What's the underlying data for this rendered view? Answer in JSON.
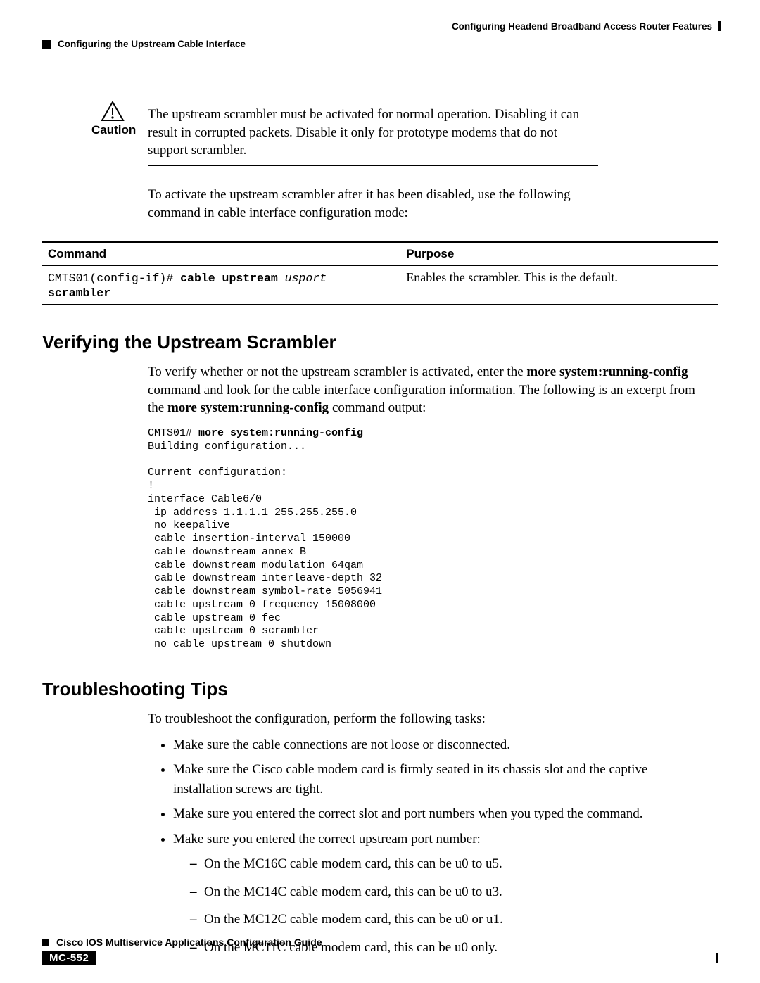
{
  "header": {
    "chapter": "Configuring Headend Broadband Access Router Features",
    "section": "Configuring the Upstream Cable Interface"
  },
  "caution": {
    "label": "Caution",
    "text": "The upstream scrambler must be activated for normal operation. Disabling it can result in corrupted packets. Disable it only for prototype modems that do not support scrambler."
  },
  "intro_para": "To activate the upstream scrambler after it has been disabled, use the following command in cable interface configuration mode:",
  "table": {
    "headers": [
      "Command",
      "Purpose"
    ],
    "row": {
      "prompt": "CMTS01(config-if)# ",
      "cmd1": "cable upstream",
      "arg": "usport",
      "cmd2": "scrambler",
      "purpose": "Enables the scrambler. This is the default."
    }
  },
  "section1": {
    "title": "Verifying the Upstream Scrambler",
    "para_pre": "To verify whether or not the upstream scrambler is activated, enter the ",
    "para_bold1": "more system:running-config",
    "para_mid": " command and look for the cable interface configuration information. The following is an excerpt from the ",
    "para_bold2": "more system:running-config",
    "para_post": " command output:",
    "config_prompt": "CMTS01# ",
    "config_cmd": "more system:running-config",
    "config_body": "Building configuration...\n\nCurrent configuration:\n!\ninterface Cable6/0\n ip address 1.1.1.1 255.255.255.0\n no keepalive\n cable insertion-interval 150000\n cable downstream annex B\n cable downstream modulation 64qam\n cable downstream interleave-depth 32\n cable downstream symbol-rate 5056941\n cable upstream 0 frequency 15008000\n cable upstream 0 fec\n cable upstream 0 scrambler\n no cable upstream 0 shutdown"
  },
  "section2": {
    "title": "Troubleshooting Tips",
    "intro": "To troubleshoot the configuration, perform the following tasks:",
    "bullets": [
      "Make sure the cable connections are not loose or disconnected.",
      "Make sure the Cisco cable modem card is firmly seated in its chassis slot and the captive installation screws are tight.",
      "Make sure you entered the correct slot and port numbers when you typed the command.",
      "Make sure you entered the correct upstream port number:"
    ],
    "subbullets": [
      "On the MC16C cable modem card, this can be u0 to u5.",
      "On the MC14C cable modem card, this can be u0 to u3.",
      "On the MC12C cable modem card, this can be u0 or u1.",
      "On the MC11C cable modem card, this can be u0 only."
    ]
  },
  "footer": {
    "book": "Cisco IOS Multiservice Applications Configuration Guide",
    "page": "MC-552"
  }
}
